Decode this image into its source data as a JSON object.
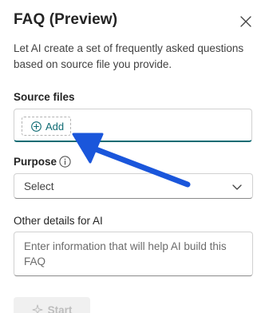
{
  "dialog": {
    "title": "FAQ (Preview)",
    "description": "Let AI create a set of frequently asked questions based on source file you provide."
  },
  "source_files": {
    "label": "Source files",
    "add_label": "Add"
  },
  "purpose": {
    "label": "Purpose",
    "selected": "Select"
  },
  "other_details": {
    "label": "Other details for AI",
    "placeholder": "Enter information that will help AI build this FAQ"
  },
  "actions": {
    "start_label": "Start"
  },
  "icons": {
    "close": "close-icon",
    "add": "plus-circle-icon",
    "info": "info-icon",
    "chevron": "chevron-down-icon",
    "start": "sparkle-icon",
    "annotation": "arrow-annotation"
  },
  "colors": {
    "accent": "#0f6b73",
    "arrow": "#1a56db",
    "disabled_text": "#bdbdbd",
    "disabled_bg": "#f0f0f0"
  }
}
